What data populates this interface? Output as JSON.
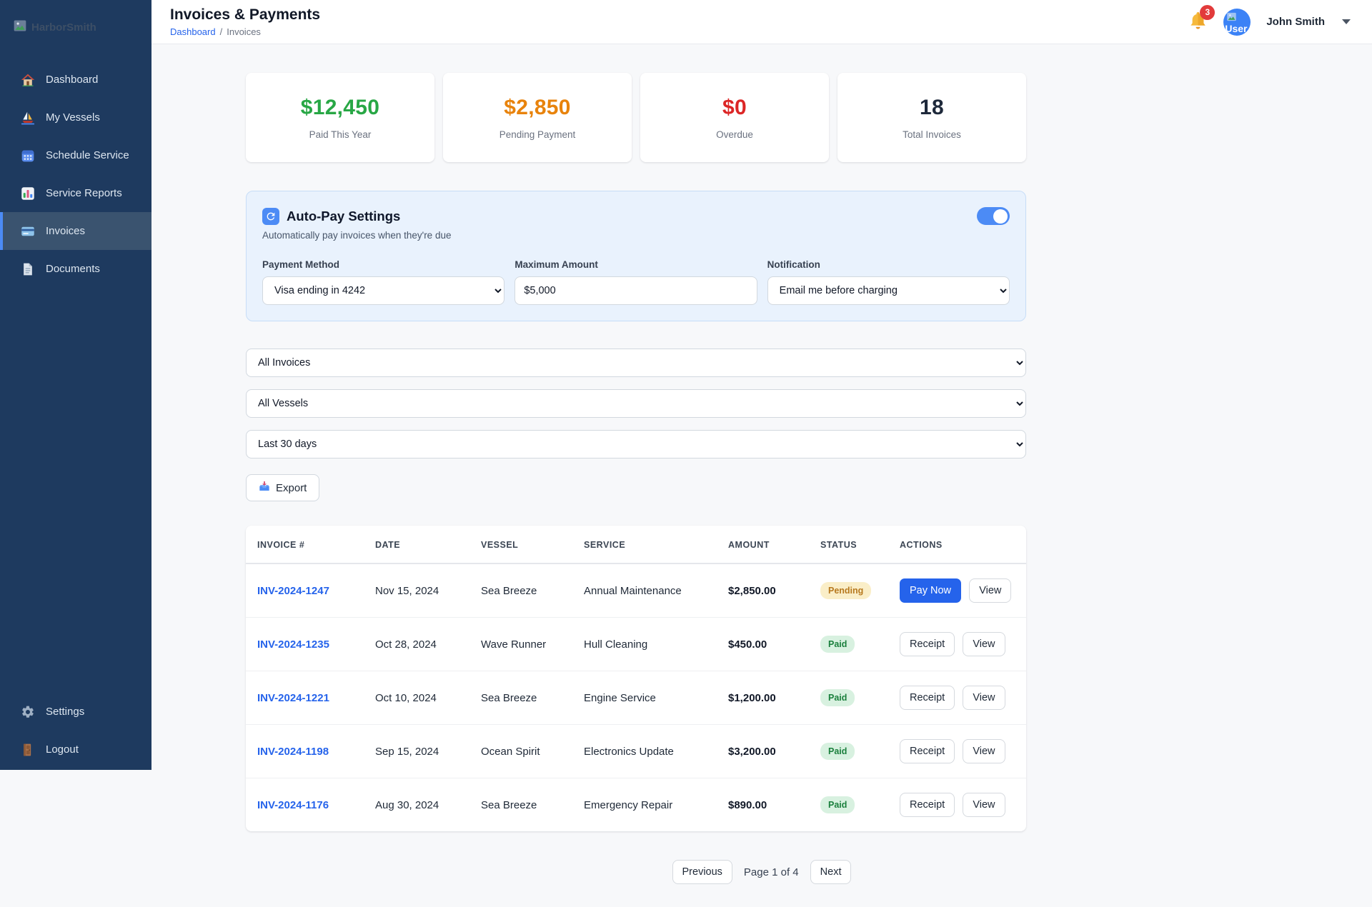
{
  "sidebar": {
    "logo_alt": "HarborSmith",
    "items": [
      {
        "label": "Dashboard",
        "icon": "house-icon"
      },
      {
        "label": "My Vessels",
        "icon": "sailboat-icon"
      },
      {
        "label": "Schedule Service",
        "icon": "calendar-icon"
      },
      {
        "label": "Service Reports",
        "icon": "bar-chart-icon"
      },
      {
        "label": "Invoices",
        "icon": "credit-card-icon",
        "active": true
      },
      {
        "label": "Documents",
        "icon": "document-icon"
      }
    ],
    "footer_items": [
      {
        "label": "Settings",
        "icon": "gear-icon"
      },
      {
        "label": "Logout",
        "icon": "door-icon"
      }
    ]
  },
  "header": {
    "title": "Invoices & Payments",
    "breadcrumb": {
      "home": "Dashboard",
      "separator": "/",
      "current": "Invoices"
    },
    "notifications_count": "3",
    "user": {
      "name": "John Smith",
      "avatar_alt": "User"
    }
  },
  "stats": [
    {
      "value": "$12,450",
      "label": "Paid This Year",
      "color": "#28a745"
    },
    {
      "value": "$2,850",
      "label": "Pending Payment",
      "color": "#e8830c"
    },
    {
      "value": "$0",
      "label": "Overdue",
      "color": "#dc2626"
    },
    {
      "value": "18",
      "label": "Total Invoices",
      "color": "#1e293b"
    }
  ],
  "autopay": {
    "title": "Auto-Pay Settings",
    "subtitle": "Automatically pay invoices when they're due",
    "enabled": true,
    "fields": {
      "payment_method": {
        "label": "Payment Method",
        "value": "Visa ending in 4242"
      },
      "max_amount": {
        "label": "Maximum Amount",
        "value": "$5,000"
      },
      "notification": {
        "label": "Notification",
        "value": "Email me before charging"
      }
    }
  },
  "filters": {
    "invoice_status": "All Invoices",
    "vessel": "All Vessels",
    "date_range": "Last 30 days",
    "export_label": "Export"
  },
  "table": {
    "columns": [
      "Invoice #",
      "Date",
      "Vessel",
      "Service",
      "Amount",
      "Status",
      "Actions"
    ],
    "rows": [
      {
        "invoice": "INV-2024-1247",
        "date": "Nov 15, 2024",
        "vessel": "Sea Breeze",
        "service": "Annual Maintenance",
        "amount": "$2,850.00",
        "status": "Pending",
        "actions": [
          "Pay Now",
          "View"
        ]
      },
      {
        "invoice": "INV-2024-1235",
        "date": "Oct 28, 2024",
        "vessel": "Wave Runner",
        "service": "Hull Cleaning",
        "amount": "$450.00",
        "status": "Paid",
        "actions": [
          "Receipt",
          "View"
        ]
      },
      {
        "invoice": "INV-2024-1221",
        "date": "Oct 10, 2024",
        "vessel": "Sea Breeze",
        "service": "Engine Service",
        "amount": "$1,200.00",
        "status": "Paid",
        "actions": [
          "Receipt",
          "View"
        ]
      },
      {
        "invoice": "INV-2024-1198",
        "date": "Sep 15, 2024",
        "vessel": "Ocean Spirit",
        "service": "Electronics Update",
        "amount": "$3,200.00",
        "status": "Paid",
        "actions": [
          "Receipt",
          "View"
        ]
      },
      {
        "invoice": "INV-2024-1176",
        "date": "Aug 30, 2024",
        "vessel": "Sea Breeze",
        "service": "Emergency Repair",
        "amount": "$890.00",
        "status": "Paid",
        "actions": [
          "Receipt",
          "View"
        ]
      }
    ]
  },
  "pagination": {
    "previous": "Previous",
    "status": "Page 1 of 4",
    "next": "Next"
  },
  "colors": {
    "sidebar_bg": "#1e3a5f",
    "accent_blue": "#2563eb",
    "toggle_on": "#4c8bf5",
    "paid_green": "#1a7f3c",
    "pending_orange": "#b7791f",
    "badge_red": "#e23b3b"
  }
}
